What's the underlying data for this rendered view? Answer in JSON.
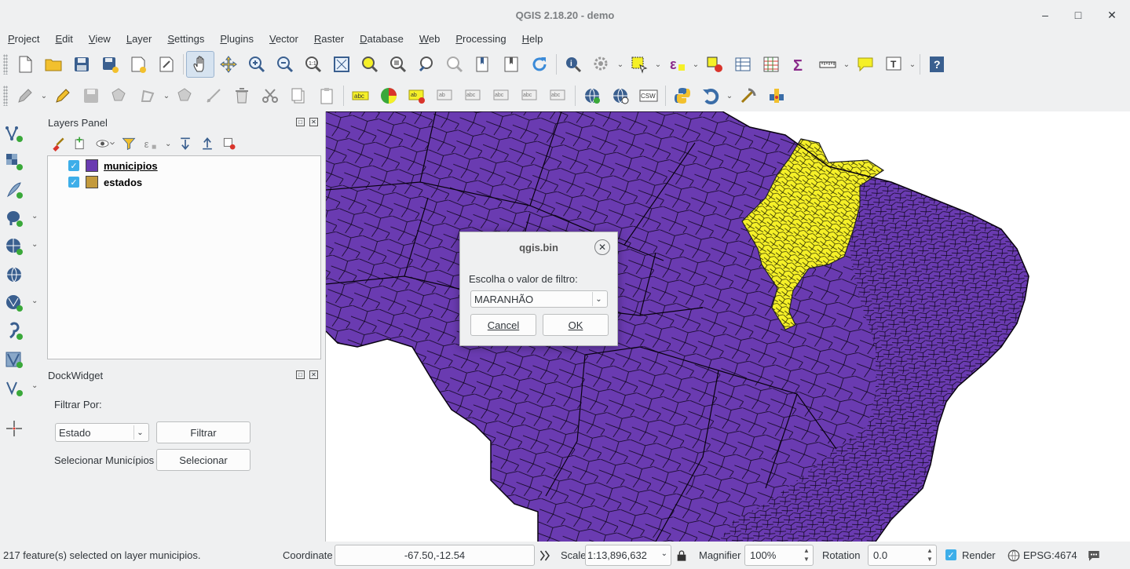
{
  "window": {
    "title": "QGIS 2.18.20 - demo",
    "minimize": "–",
    "maximize": "□",
    "close": "✕"
  },
  "menu": [
    "Project",
    "Edit",
    "View",
    "Layer",
    "Settings",
    "Plugins",
    "Vector",
    "Raster",
    "Database",
    "Web",
    "Processing",
    "Help"
  ],
  "layers_panel": {
    "title": "Layers Panel",
    "layers": [
      {
        "name": "municipios",
        "color": "#6a3bb1",
        "checked": true
      },
      {
        "name": "estados",
        "color": "#c39a3d",
        "checked": true
      }
    ]
  },
  "dock_widget": {
    "title": "DockWidget",
    "filter_label": "Filtrar Por:",
    "filter_combo_value": "Estado",
    "filter_button": "Filtrar",
    "select_label": "Selecionar Municípios",
    "select_button": "Selecionar"
  },
  "dialog": {
    "title": "qgis.bin",
    "prompt": "Escolha o valor de filtro:",
    "combo_value": "MARANHÃO",
    "cancel": "Cancel",
    "ok": "OK"
  },
  "map": {
    "base_color": "#6a3bb1",
    "highlight_color": "#f5f028"
  },
  "status": {
    "message": "217 feature(s) selected on layer municipios.",
    "coordinate_label": "Coordinate",
    "coordinate_value": "-67.50,-12.54",
    "scale_label": "Scale",
    "scale_value": "1:13,896,632",
    "magnifier_label": "Magnifier",
    "magnifier_value": "100%",
    "rotation_label": "Rotation",
    "rotation_value": "0.0",
    "render_label": "Render",
    "crs": "EPSG:4674"
  }
}
